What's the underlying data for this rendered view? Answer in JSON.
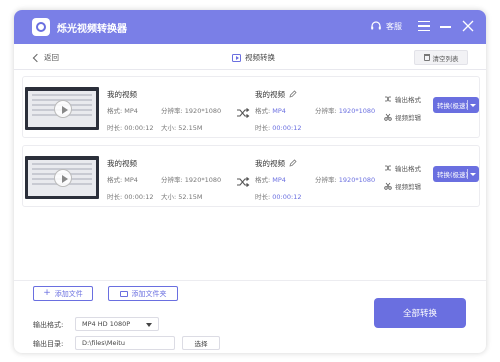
{
  "app": {
    "title": "烁光视频转换器",
    "customer_service": "客服"
  },
  "subbar": {
    "back_label": "返回",
    "section_title": "视频转换",
    "clear_label": "清空列表"
  },
  "files": [
    {
      "input": {
        "name": "我的视频",
        "format_label": "格式:",
        "format": "MP4",
        "resolution_label": "分辨率:",
        "resolution": "1920*1080",
        "duration_label": "时长:",
        "duration": "00:00:12",
        "size_label": "大小:",
        "size": "52.15M"
      },
      "output": {
        "name": "我的视频",
        "format_label": "格式:",
        "format": "MP4",
        "resolution_label": "分辨率:",
        "resolution": "1920*1080",
        "duration_label": "时长:",
        "duration": "00:00:12"
      },
      "options": {
        "output_format": "输出格式",
        "video_edit": "视频剪辑"
      },
      "convert_label": "转换(极速)"
    },
    {
      "input": {
        "name": "我的视频",
        "format_label": "格式:",
        "format": "MP4",
        "resolution_label": "分辨率:",
        "resolution": "1920*1080",
        "duration_label": "时长:",
        "duration": "00:00:12",
        "size_label": "大小:",
        "size": "52.15M"
      },
      "output": {
        "name": "我的视频",
        "format_label": "格式:",
        "format": "MP4",
        "resolution_label": "分辨率:",
        "resolution": "1920*1080",
        "duration_label": "时长:",
        "duration": "00:00:12"
      },
      "options": {
        "output_format": "输出格式",
        "video_edit": "视频剪辑"
      },
      "convert_label": "转换(极速)"
    }
  ],
  "bottom": {
    "add_file": "添加文件",
    "add_folder": "添加文件夹",
    "output_format_label": "输出格式:",
    "output_format_value": "MP4 HD 1080P",
    "output_dir_label": "输出目录:",
    "output_dir_value": "D:\\files\\Meitu",
    "browse": "选择",
    "convert_all": "全部转换"
  },
  "colors": {
    "accent": "#6a6fe0",
    "titlebar": "#7a7fe7"
  },
  "icons": [
    "headset-icon",
    "menu-icon",
    "minimize-icon",
    "close-icon",
    "back-chevron-icon",
    "video-icon",
    "trash-icon",
    "play-icon",
    "shuffle-icon",
    "pencil-icon",
    "output-format-icon",
    "scissors-icon",
    "plus-icon",
    "folder-icon",
    "dropdown-icon"
  ]
}
